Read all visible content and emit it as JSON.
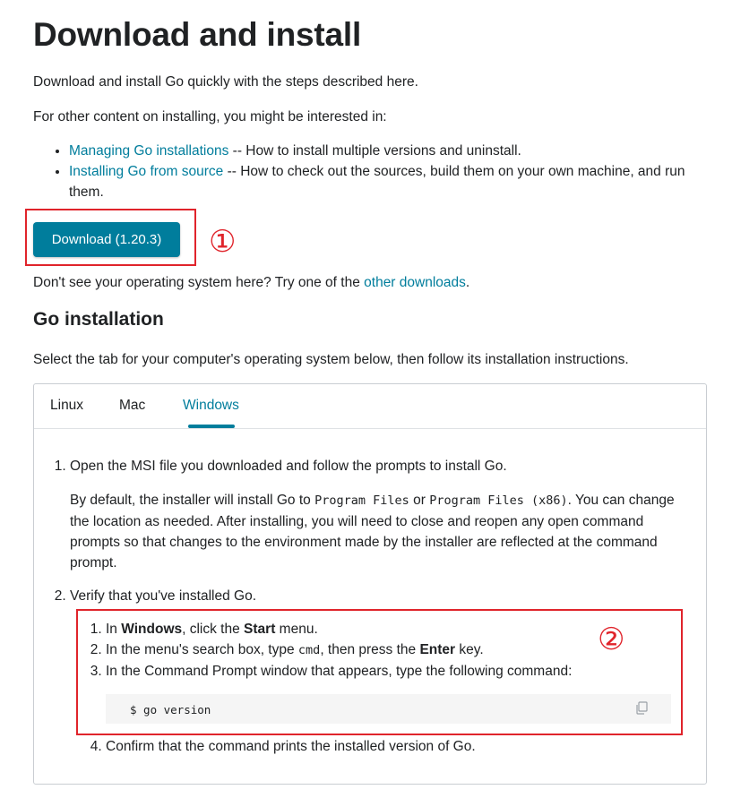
{
  "title": "Download and install",
  "intro": "Download and install Go quickly with the steps described here.",
  "other_intro": "For other content on installing, you might be interested in:",
  "links": [
    {
      "link": "Managing Go installations",
      "rest": " -- How to install multiple versions and uninstall."
    },
    {
      "link": "Installing Go from source",
      "rest": " -- How to check out the sources, build them on your own machine, and run them."
    }
  ],
  "download_button": "Download (1.20.3)",
  "marker1": "①",
  "marker2": "②",
  "dont_see": {
    "before": "Don't see your operating system here? Try one of the ",
    "link": "other downloads",
    "after": "."
  },
  "section_title": "Go installation",
  "select_tab": "Select the tab for your computer's operating system below, then follow its installation instructions.",
  "tabs": [
    "Linux",
    "Mac",
    "Windows"
  ],
  "active_tab": "Windows",
  "steps": {
    "step1": "Open the MSI file you downloaded and follow the prompts to install Go.",
    "step1_desc": {
      "a": "By default, the installer will install Go to ",
      "code1": "Program Files",
      "b": " or ",
      "code2": "Program Files (x86)",
      "c": ". You can change the location as needed. After installing, you will need to close and reopen any open command prompts so that changes to the environment made by the installer are reflected at the command prompt."
    },
    "step2": "Verify that you've installed Go.",
    "sub": {
      "s1_a": "In ",
      "s1_b": "Windows",
      "s1_c": ", click the ",
      "s1_d": "Start",
      "s1_e": " menu.",
      "s2_a": "In the menu's search box, type ",
      "s2_code": "cmd",
      "s2_b": ", then press the ",
      "s2_c": "Enter",
      "s2_d": " key.",
      "s3": "In the Command Prompt window that appears, type the following command:",
      "command": "$ go version",
      "s4": "Confirm that the command prints the installed version of Go."
    }
  },
  "colors": {
    "accent": "#007d9c",
    "annotation": "#e0242b"
  },
  "icons": {
    "copy": "copy-icon"
  }
}
